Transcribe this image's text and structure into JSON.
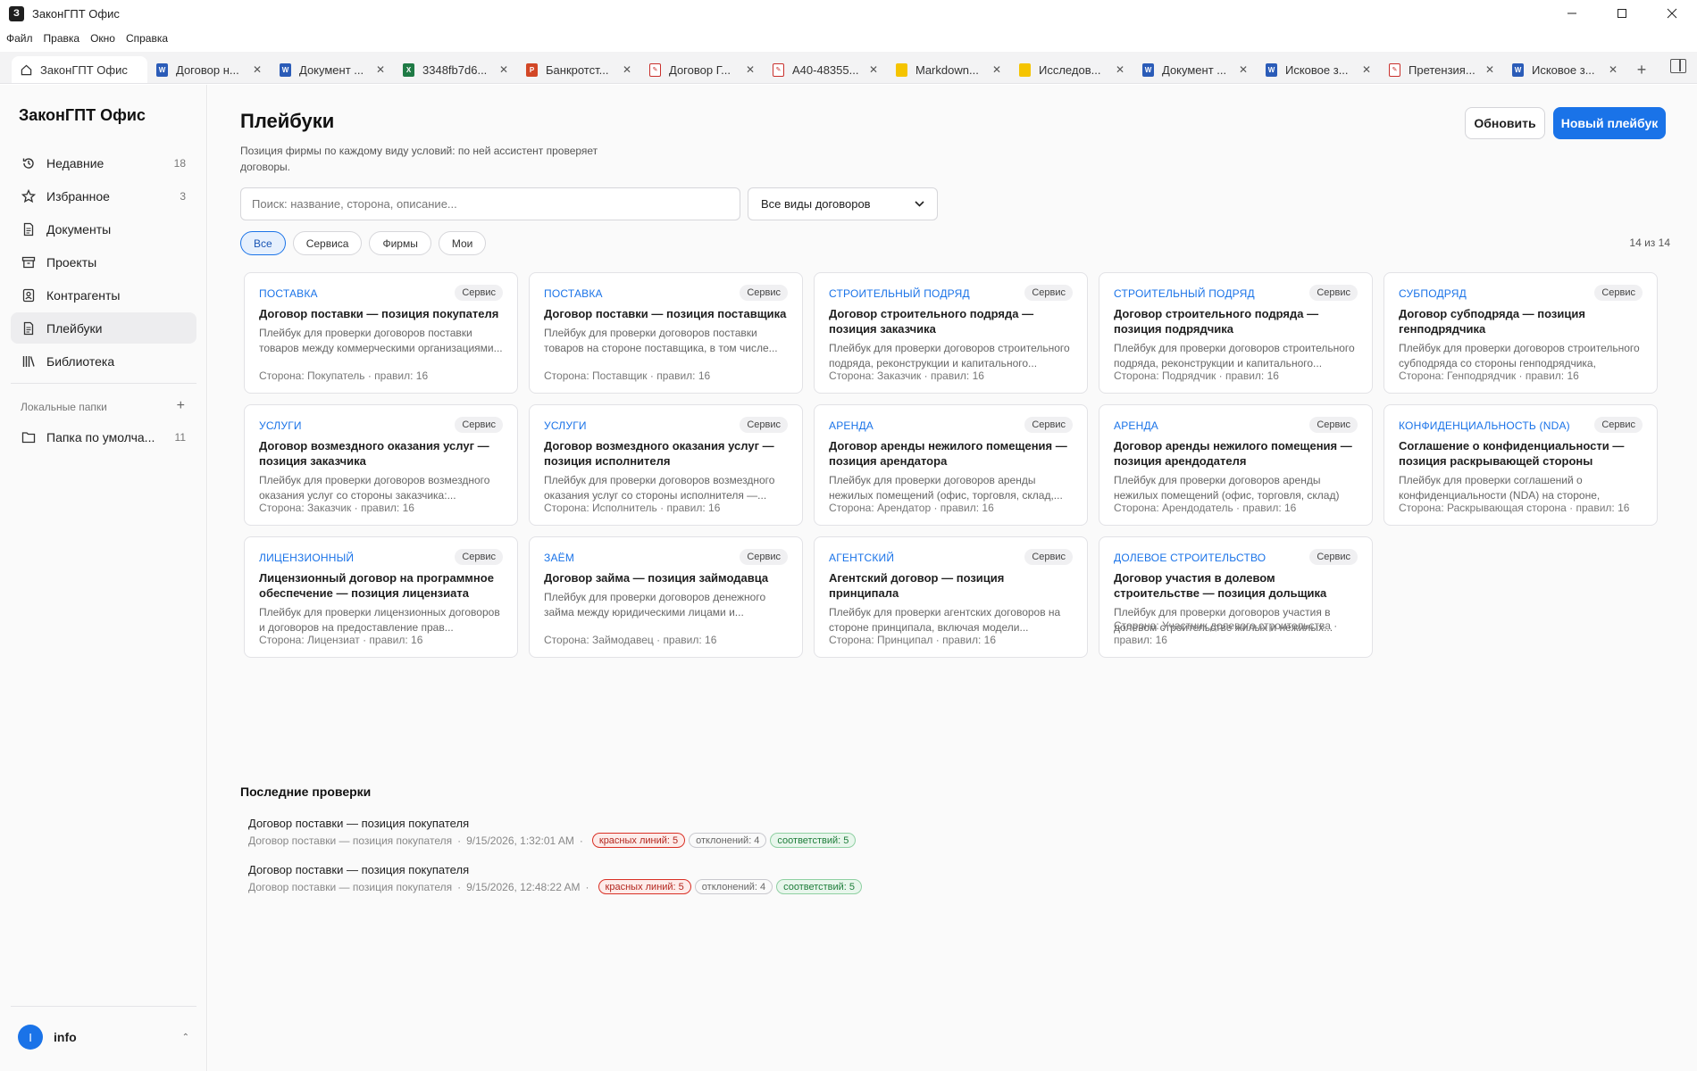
{
  "app": {
    "icon_letter": "З",
    "title": "ЗаконГПТ Офис"
  },
  "menu": [
    "Файл",
    "Правка",
    "Окно",
    "Справка"
  ],
  "tabs": [
    {
      "label": "ЗаконГПТ Офис",
      "icon": "home-icon",
      "active": true
    },
    {
      "label": "Договор н...",
      "icon": "word-icon"
    },
    {
      "label": "Документ ...",
      "icon": "word-icon"
    },
    {
      "label": "3348fb7d6...",
      "icon": "excel-icon"
    },
    {
      "label": "Банкротст...",
      "icon": "ppt-icon"
    },
    {
      "label": "Договор Г...",
      "icon": "pdf-icon"
    },
    {
      "label": "А40-48355...",
      "icon": "pdf-icon"
    },
    {
      "label": "Markdown...",
      "icon": "markdown-icon"
    },
    {
      "label": "Исследов...",
      "icon": "markdown-icon"
    },
    {
      "label": "Документ ...",
      "icon": "word-icon"
    },
    {
      "label": "Исковое з...",
      "icon": "word-icon"
    },
    {
      "label": "Претензия...",
      "icon": "pdf-icon"
    },
    {
      "label": "Исковое з...",
      "icon": "word-icon"
    }
  ],
  "sidebar": {
    "brand": "ЗаконГПТ Офис",
    "items": [
      {
        "label": "Недавние",
        "count": "18",
        "icon": "history-icon"
      },
      {
        "label": "Избранное",
        "count": "3",
        "icon": "star-icon"
      },
      {
        "label": "Документы",
        "count": "",
        "icon": "document-icon"
      },
      {
        "label": "Проекты",
        "count": "",
        "icon": "archive-icon"
      },
      {
        "label": "Контрагенты",
        "count": "",
        "icon": "contacts-icon"
      },
      {
        "label": "Плейбуки",
        "count": "",
        "icon": "playbook-icon",
        "active": true
      },
      {
        "label": "Библиотека",
        "count": "",
        "icon": "library-icon"
      }
    ],
    "folders_heading": "Локальные папки",
    "folders": [
      {
        "label": "Папка по умолча...",
        "count": "11"
      }
    ],
    "user": {
      "initial": "I",
      "name": "info"
    }
  },
  "page": {
    "title": "Плейбуки",
    "subtitle": "Позиция фирмы по каждому виду условий: по ней ассистент проверяет договоры.",
    "refresh_label": "Обновить",
    "new_label": "Новый плейбук",
    "search_placeholder": "Поиск: название, сторона, описание...",
    "select_value": "Все виды договоров",
    "filters": [
      {
        "label": "Все",
        "active": true
      },
      {
        "label": "Сервиса"
      },
      {
        "label": "Фирмы"
      },
      {
        "label": "Мои"
      }
    ],
    "count_text": "14 из 14"
  },
  "cards": [
    {
      "category": "Поставка",
      "badge": "Сервис",
      "title": "Договор поставки — позиция покупателя",
      "desc": "Плейбук для проверки договоров поставки товаров между коммерческими организациями...",
      "side": "Сторона: Покупатель",
      "rules": "правил: 16"
    },
    {
      "category": "Поставка",
      "badge": "Сервис",
      "title": "Договор поставки — позиция поставщика",
      "desc": "Плейбук для проверки договоров поставки товаров на стороне поставщика, в том числе...",
      "side": "Сторона: Поставщик",
      "rules": "правил: 16"
    },
    {
      "category": "Строительный подряд",
      "badge": "Сервис",
      "title": "Договор строительного подряда — позиция заказчика",
      "desc": "Плейбук для проверки договоров строительного подряда, реконструкции и капитального...",
      "side": "Сторона: Заказчик",
      "rules": "правил: 16"
    },
    {
      "category": "Строительный подряд",
      "badge": "Сервис",
      "title": "Договор строительного подряда — позиция подрядчика",
      "desc": "Плейбук для проверки договоров строительного подряда, реконструкции и капитального...",
      "side": "Сторона: Подрядчик",
      "rules": "правил: 16"
    },
    {
      "category": "Субподряд",
      "badge": "Сервис",
      "title": "Договор субподряда — позиция генподрядчика",
      "desc": "Плейбук для проверки договоров строительного субподряда со стороны генподрядчика, которы...",
      "side": "Сторона: Генподрядчик",
      "rules": "правил: 16"
    },
    {
      "category": "Услуги",
      "badge": "Сервис",
      "title": "Договор возмездного оказания услуг — позиция заказчика",
      "desc": "Плейбук для проверки договоров возмездного оказания услуг со стороны заказчика:...",
      "side": "Сторона: Заказчик",
      "rules": "правил: 16"
    },
    {
      "category": "Услуги",
      "badge": "Сервис",
      "title": "Договор возмездного оказания услуг — позиция исполнителя",
      "desc": "Плейбук для проверки договоров возмездного оказания услуг со стороны исполнителя —...",
      "side": "Сторона: Исполнитель",
      "rules": "правил: 16"
    },
    {
      "category": "Аренда",
      "badge": "Сервис",
      "title": "Договор аренды нежилого помещения — позиция арендатора",
      "desc": "Плейбук для проверки договоров аренды нежилых помещений (офис, торговля, склад,...",
      "side": "Сторона: Арендатор",
      "rules": "правил: 16"
    },
    {
      "category": "Аренда",
      "badge": "Сервис",
      "title": "Договор аренды нежилого помещения — позиция арендодателя",
      "desc": "Плейбук для проверки договоров аренды нежилых помещений (офис, торговля, склад) на...",
      "side": "Сторона: Арендодатель",
      "rules": "правил: 16"
    },
    {
      "category": "Конфиденциальность (NDA)",
      "badge": "Сервис",
      "title": "Соглашение о конфиденциальности — позиция раскрывающей стороны",
      "desc": "Плейбук для проверки соглашений о конфиденциальности (NDA) на стороне, котора...",
      "side": "Сторона: Раскрывающая сторона",
      "rules": "правил: 16"
    },
    {
      "category": "Лицензионный",
      "badge": "Сервис",
      "title": "Лицензионный договор на программное обеспечение — позиция лицензиата",
      "desc": "Плейбук для проверки лицензионных договоров и договоров на предоставление прав...",
      "side": "Сторона: Лицензиат",
      "rules": "правил: 16"
    },
    {
      "category": "Заём",
      "badge": "Сервис",
      "title": "Договор займа — позиция займодавца",
      "desc": "Плейбук для проверки договоров денежного займа между юридическими лицами и...",
      "side": "Сторона: Займодавец",
      "rules": "правил: 16"
    },
    {
      "category": "Агентский",
      "badge": "Сервис",
      "title": "Агентский договор — позиция принципала",
      "desc": "Плейбук для проверки агентских договоров на стороне принципала, включая модели...",
      "side": "Сторона: Принципал",
      "rules": "правил: 16"
    },
    {
      "category": "Долевое строительство",
      "badge": "Сервис",
      "title": "Договор участия в долевом строительстве — позиция дольщика",
      "desc": "Плейбук для проверки договоров участия в долевом строительстве жилых и нежилых...",
      "side": "Сторона: Участник долевого строительства",
      "rules": "правил: 16"
    }
  ],
  "recent": {
    "title": "Последние проверки",
    "items": [
      {
        "name": "Договор поставки — позиция покупателя",
        "playbook": "Договор поставки — позиция покупателя",
        "time": "9/15/2026, 1:32:01 AM",
        "red": "красных линий: 5",
        "dev": "отклонений: 4",
        "ok": "соответствий: 5"
      },
      {
        "name": "Договор поставки — позиция покупателя",
        "playbook": "Договор поставки — позиция покупателя",
        "time": "9/15/2026, 12:48:22 AM",
        "red": "красных линий: 5",
        "dev": "отклонений: 4",
        "ok": "соответствий: 5"
      }
    ]
  },
  "colors": {
    "accent": "#1a73e8",
    "red": "#d93025",
    "green": "#1e7d3a"
  }
}
